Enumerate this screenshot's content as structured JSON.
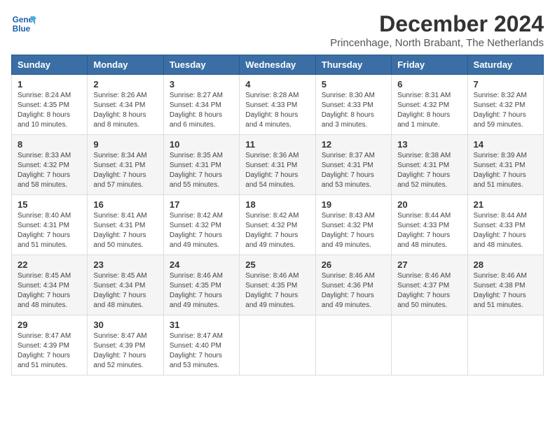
{
  "header": {
    "logo_line1": "General",
    "logo_line2": "Blue",
    "title": "December 2024",
    "subtitle": "Princenhage, North Brabant, The Netherlands"
  },
  "calendar": {
    "days_of_week": [
      "Sunday",
      "Monday",
      "Tuesday",
      "Wednesday",
      "Thursday",
      "Friday",
      "Saturday"
    ],
    "weeks": [
      [
        {
          "day": "1",
          "sunrise": "8:24 AM",
          "sunset": "4:35 PM",
          "daylight": "8 hours and 10 minutes."
        },
        {
          "day": "2",
          "sunrise": "8:26 AM",
          "sunset": "4:34 PM",
          "daylight": "8 hours and 8 minutes."
        },
        {
          "day": "3",
          "sunrise": "8:27 AM",
          "sunset": "4:34 PM",
          "daylight": "8 hours and 6 minutes."
        },
        {
          "day": "4",
          "sunrise": "8:28 AM",
          "sunset": "4:33 PM",
          "daylight": "8 hours and 4 minutes."
        },
        {
          "day": "5",
          "sunrise": "8:30 AM",
          "sunset": "4:33 PM",
          "daylight": "8 hours and 3 minutes."
        },
        {
          "day": "6",
          "sunrise": "8:31 AM",
          "sunset": "4:32 PM",
          "daylight": "8 hours and 1 minute."
        },
        {
          "day": "7",
          "sunrise": "8:32 AM",
          "sunset": "4:32 PM",
          "daylight": "7 hours and 59 minutes."
        }
      ],
      [
        {
          "day": "8",
          "sunrise": "8:33 AM",
          "sunset": "4:32 PM",
          "daylight": "7 hours and 58 minutes."
        },
        {
          "day": "9",
          "sunrise": "8:34 AM",
          "sunset": "4:31 PM",
          "daylight": "7 hours and 57 minutes."
        },
        {
          "day": "10",
          "sunrise": "8:35 AM",
          "sunset": "4:31 PM",
          "daylight": "7 hours and 55 minutes."
        },
        {
          "day": "11",
          "sunrise": "8:36 AM",
          "sunset": "4:31 PM",
          "daylight": "7 hours and 54 minutes."
        },
        {
          "day": "12",
          "sunrise": "8:37 AM",
          "sunset": "4:31 PM",
          "daylight": "7 hours and 53 minutes."
        },
        {
          "day": "13",
          "sunrise": "8:38 AM",
          "sunset": "4:31 PM",
          "daylight": "7 hours and 52 minutes."
        },
        {
          "day": "14",
          "sunrise": "8:39 AM",
          "sunset": "4:31 PM",
          "daylight": "7 hours and 51 minutes."
        }
      ],
      [
        {
          "day": "15",
          "sunrise": "8:40 AM",
          "sunset": "4:31 PM",
          "daylight": "7 hours and 51 minutes."
        },
        {
          "day": "16",
          "sunrise": "8:41 AM",
          "sunset": "4:31 PM",
          "daylight": "7 hours and 50 minutes."
        },
        {
          "day": "17",
          "sunrise": "8:42 AM",
          "sunset": "4:32 PM",
          "daylight": "7 hours and 49 minutes."
        },
        {
          "day": "18",
          "sunrise": "8:42 AM",
          "sunset": "4:32 PM",
          "daylight": "7 hours and 49 minutes."
        },
        {
          "day": "19",
          "sunrise": "8:43 AM",
          "sunset": "4:32 PM",
          "daylight": "7 hours and 49 minutes."
        },
        {
          "day": "20",
          "sunrise": "8:44 AM",
          "sunset": "4:33 PM",
          "daylight": "7 hours and 48 minutes."
        },
        {
          "day": "21",
          "sunrise": "8:44 AM",
          "sunset": "4:33 PM",
          "daylight": "7 hours and 48 minutes."
        }
      ],
      [
        {
          "day": "22",
          "sunrise": "8:45 AM",
          "sunset": "4:34 PM",
          "daylight": "7 hours and 48 minutes."
        },
        {
          "day": "23",
          "sunrise": "8:45 AM",
          "sunset": "4:34 PM",
          "daylight": "7 hours and 48 minutes."
        },
        {
          "day": "24",
          "sunrise": "8:46 AM",
          "sunset": "4:35 PM",
          "daylight": "7 hours and 49 minutes."
        },
        {
          "day": "25",
          "sunrise": "8:46 AM",
          "sunset": "4:35 PM",
          "daylight": "7 hours and 49 minutes."
        },
        {
          "day": "26",
          "sunrise": "8:46 AM",
          "sunset": "4:36 PM",
          "daylight": "7 hours and 49 minutes."
        },
        {
          "day": "27",
          "sunrise": "8:46 AM",
          "sunset": "4:37 PM",
          "daylight": "7 hours and 50 minutes."
        },
        {
          "day": "28",
          "sunrise": "8:46 AM",
          "sunset": "4:38 PM",
          "daylight": "7 hours and 51 minutes."
        }
      ],
      [
        {
          "day": "29",
          "sunrise": "8:47 AM",
          "sunset": "4:39 PM",
          "daylight": "7 hours and 51 minutes."
        },
        {
          "day": "30",
          "sunrise": "8:47 AM",
          "sunset": "4:39 PM",
          "daylight": "7 hours and 52 minutes."
        },
        {
          "day": "31",
          "sunrise": "8:47 AM",
          "sunset": "4:40 PM",
          "daylight": "7 hours and 53 minutes."
        },
        null,
        null,
        null,
        null
      ]
    ]
  }
}
